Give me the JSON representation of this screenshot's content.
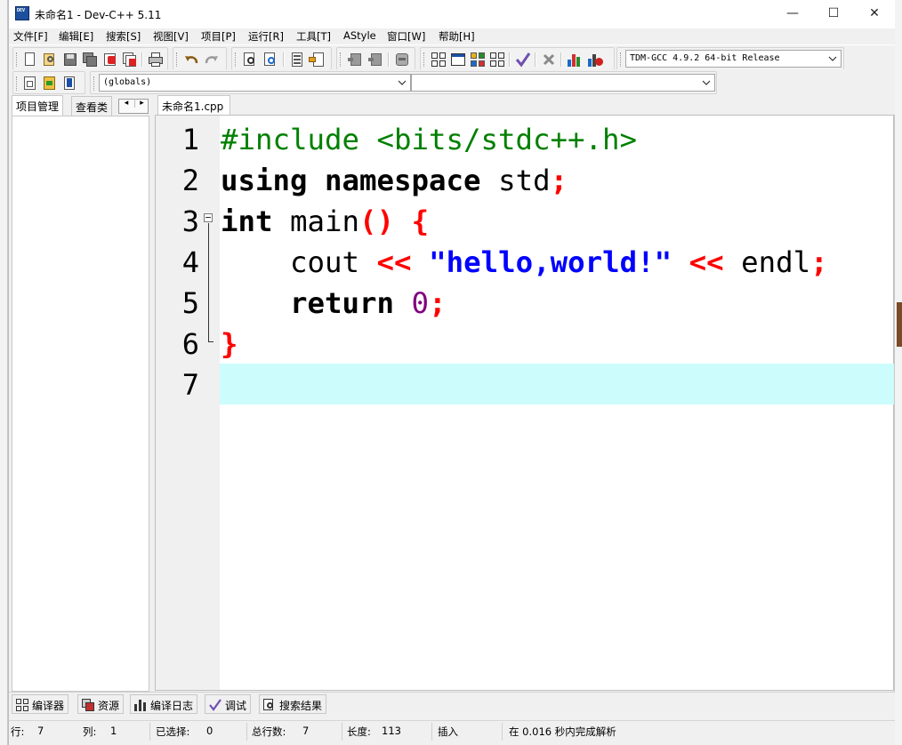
{
  "window": {
    "title": "未命名1 - Dev-C++ 5.11",
    "icon_text": "DEV",
    "controls": {
      "minimize": "—",
      "maximize": "☐",
      "close": "✕"
    }
  },
  "menu": [
    "文件[F]",
    "编辑[E]",
    "搜索[S]",
    "视图[V]",
    "项目[P]",
    "运行[R]",
    "工具[T]",
    "AStyle",
    "窗口[W]",
    "帮助[H]"
  ],
  "toolbar": {
    "compiler_select": "TDM-GCC 4.9.2 64-bit Release",
    "scope_select": "(globals)",
    "member_select": ""
  },
  "left_panel": {
    "tabs": [
      "项目管理",
      "查看类"
    ],
    "scroll_left": "◂",
    "scroll_right": "▸"
  },
  "editor": {
    "tab_label": "未命名1.cpp",
    "line_numbers": [
      "1",
      "2",
      "3",
      "4",
      "5",
      "6",
      "7"
    ],
    "code": {
      "l1": {
        "text": "#include <bits/stdc++.h>"
      },
      "l2": {
        "kw1": "using",
        "kw2": "namespace",
        "id": "std",
        "op": ";"
      },
      "l3": {
        "kw": "int",
        "id": "main",
        "parens": "()",
        "brace": "{"
      },
      "l4": {
        "id1": "cout",
        "op1": "<<",
        "str": "\"hello,world!\"",
        "op2": "<<",
        "id2": "endl",
        "semi": ";"
      },
      "l5": {
        "kw": "return",
        "num": "0",
        "semi": ";"
      },
      "l6": {
        "brace": "}"
      },
      "l7": {
        "text": ""
      }
    },
    "current_line": 7,
    "colors": {
      "preprocessor": "#008000",
      "operator": "#ff0000",
      "string": "#0000ff",
      "number": "#800080",
      "current_line_bg": "#ccfcfc"
    }
  },
  "bottom_tabs": [
    "编译器",
    "资源",
    "编译日志",
    "调试",
    "搜索结果"
  ],
  "status": {
    "line_label": "行:",
    "line_value": "7",
    "col_label": "列:",
    "col_value": "1",
    "sel_label": "已选择:",
    "sel_value": "0",
    "total_label": "总行数:",
    "total_value": "7",
    "len_label": "长度:",
    "len_value": "113",
    "mode": "插入",
    "parse_msg": "在 0.016 秒内完成解析"
  }
}
